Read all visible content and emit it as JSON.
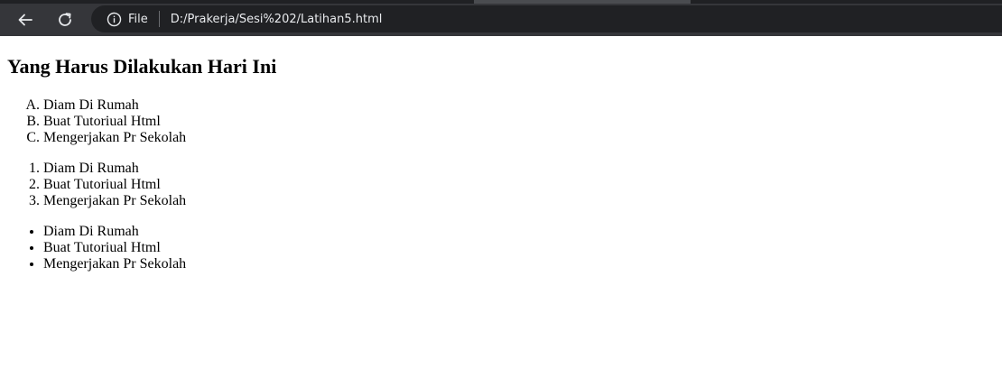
{
  "browser": {
    "nav": {
      "back_icon": "arrow-left-icon",
      "reload_icon": "reload-icon"
    },
    "address_bar": {
      "info_icon": "info-circle-icon",
      "scheme_label": "File",
      "url": "D:/Prakerja/Sesi%202/Latihan5.html"
    },
    "colors": {
      "toolbar_bg": "#35363a",
      "omnibox_bg": "#202124",
      "text": "#e8eaed"
    }
  },
  "page": {
    "heading": "Yang Harus Dilakukan Hari Ini",
    "lists": {
      "alpha": {
        "style": "upper-alpha",
        "items": [
          "Diam Di Rumah",
          "Buat Tutoriual Html",
          "Mengerjakan Pr Sekolah"
        ]
      },
      "numbered": {
        "style": "decimal",
        "items": [
          "Diam Di Rumah",
          "Buat Tutoriual Html",
          "Mengerjakan Pr Sekolah"
        ]
      },
      "bulleted": {
        "style": "disc",
        "items": [
          "Diam Di Rumah",
          "Buat Tutoriual Html",
          "Mengerjakan Pr Sekolah"
        ]
      }
    }
  }
}
